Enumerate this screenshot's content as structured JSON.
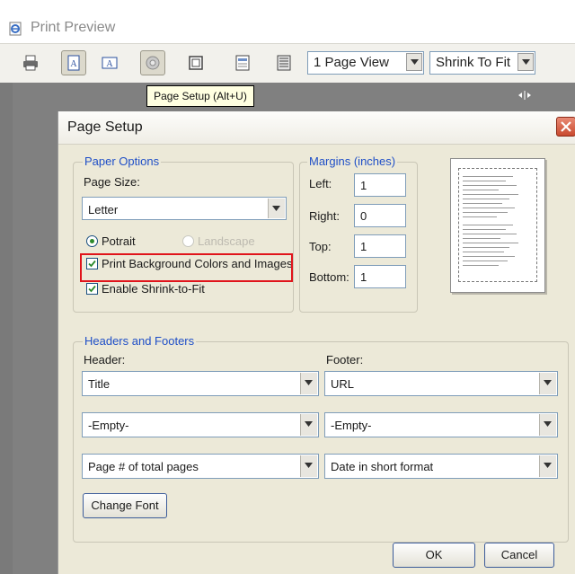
{
  "window": {
    "title": "Print Preview",
    "icon": "ie-page-icon"
  },
  "toolbar": {
    "buttons": [
      {
        "icon": "print-icon"
      },
      {
        "icon": "portrait-icon",
        "pressed": true
      },
      {
        "icon": "landscape-icon"
      },
      {
        "icon": "page-setup-icon"
      },
      {
        "icon": "full-width-icon"
      },
      {
        "icon": "headers-footers-icon"
      },
      {
        "icon": "full-page-icon"
      }
    ],
    "page_view": "1 Page View",
    "scale": "Shrink To Fit"
  },
  "tooltip": "Page Setup (Alt+U)",
  "dialog": {
    "title": "Page Setup",
    "paper_options": {
      "legend": "Paper Options",
      "page_size_label": "Page Size:",
      "page_size_value": "Letter",
      "portrait_label": "Potrait",
      "landscape_label": "Landscape",
      "portrait_selected": true,
      "print_bg_label": "Print Background Colors and Images",
      "print_bg_checked": true,
      "shrink_label": "Enable Shrink-to-Fit",
      "shrink_checked": true
    },
    "margins": {
      "legend": "Margins (inches)",
      "left_label": "Left:",
      "left_value": "1",
      "right_label": "Right:",
      "right_value": "0",
      "top_label": "Top:",
      "top_value": "1",
      "bottom_label": "Bottom:",
      "bottom_value": "1"
    },
    "headers_footers": {
      "legend": "Headers and Footers",
      "header_label": "Header:",
      "footer_label": "Footer:",
      "header_values": [
        "Title",
        "-Empty-",
        "Page # of total pages"
      ],
      "footer_values": [
        "URL",
        "-Empty-",
        "Date in short format"
      ],
      "change_font_label": "Change Font"
    },
    "ok_label": "OK",
    "cancel_label": "Cancel"
  },
  "colors": {
    "highlight": "#e0141b",
    "legend_text": "#1f4fc7",
    "dialog_bg": "#ece9d8"
  }
}
